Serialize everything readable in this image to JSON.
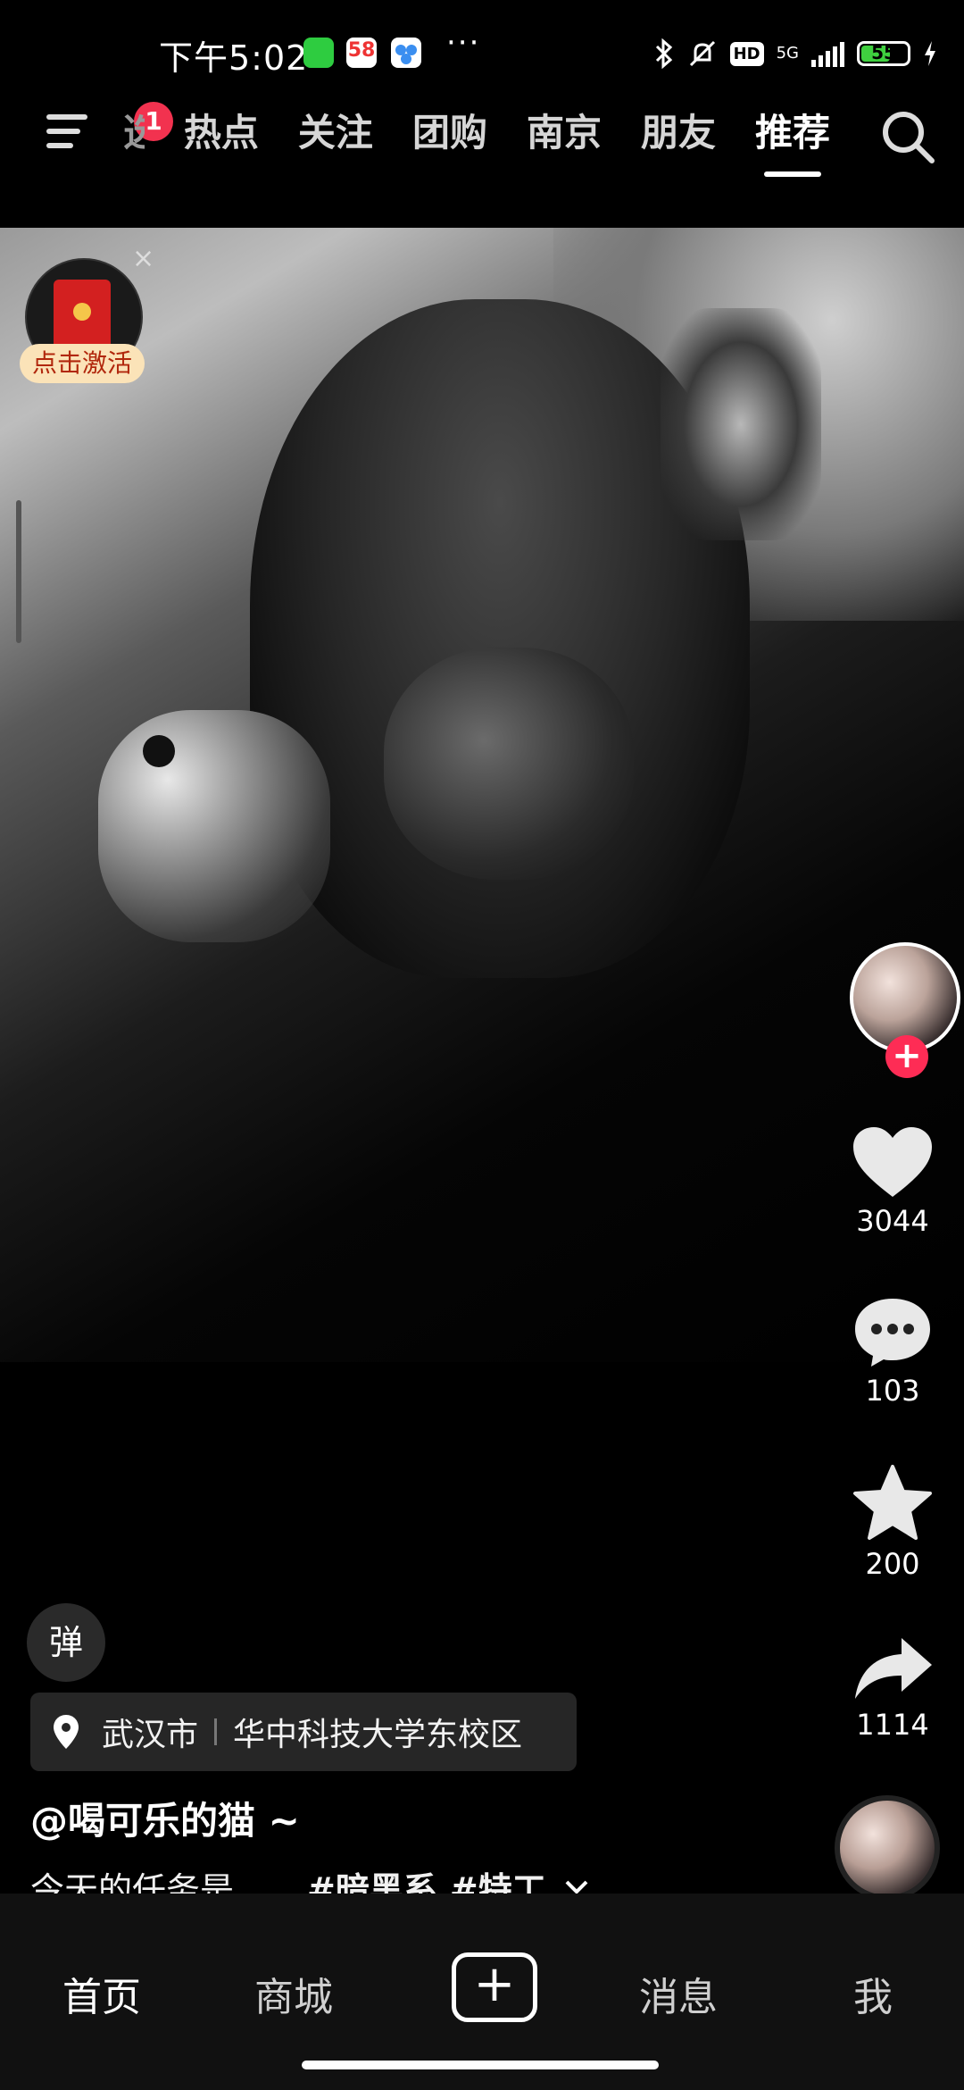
{
  "status_bar": {
    "time": "下午5:02",
    "app_icon_58": "58",
    "more": "···",
    "hd": "HD",
    "network": "5G",
    "battery": "55"
  },
  "top_nav": {
    "notification_count": "1",
    "tabs": [
      {
        "label": "选",
        "active": false
      },
      {
        "label": "热点",
        "active": false
      },
      {
        "label": "关注",
        "active": false
      },
      {
        "label": "团购",
        "active": false
      },
      {
        "label": "南京",
        "active": false
      },
      {
        "label": "朋友",
        "active": false
      },
      {
        "label": "推荐",
        "active": true
      }
    ]
  },
  "red_packet": {
    "label": "点击激活",
    "close": "×"
  },
  "actions": {
    "likes": "3044",
    "comments": "103",
    "favorites": "200",
    "shares": "1114"
  },
  "danmu_label": "弹",
  "location": {
    "city": "武汉市",
    "place": "华中科技大学东校区"
  },
  "post": {
    "author": "@喝可乐的猫 ~",
    "caption": "今天的任务是……",
    "tags": [
      "#暗黑系",
      "#特工"
    ]
  },
  "bottom_nav": {
    "home": "首页",
    "mall": "商城",
    "create": "+",
    "messages": "消息",
    "me": "我"
  },
  "colors": {
    "accent_red": "#fe2c55",
    "badge_red": "#f2324f",
    "battery_green": "#3fd03f"
  }
}
